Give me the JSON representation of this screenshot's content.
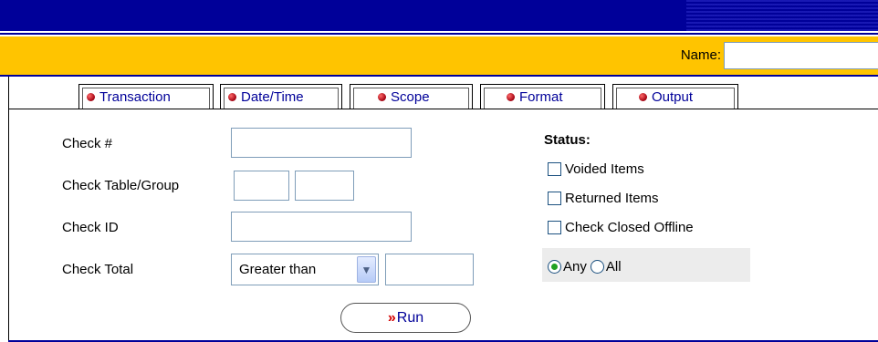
{
  "header": {
    "name_label": "Name:",
    "name_value": ""
  },
  "tabs": [
    {
      "label": "Transaction",
      "active": true
    },
    {
      "label": "Date/Time",
      "active": false
    },
    {
      "label": "Scope",
      "active": false
    },
    {
      "label": "Format",
      "active": false
    },
    {
      "label": "Output",
      "active": false
    }
  ],
  "form": {
    "check_number_label": "Check #",
    "check_table_group_label": "Check Table/Group",
    "check_id_label": "Check ID",
    "check_total_label": "Check Total",
    "check_total_operator": "Greater than",
    "run_label": "Run",
    "run_chevron": "»"
  },
  "status": {
    "title": "Status:",
    "options": [
      {
        "label": "Voided Items",
        "checked": false
      },
      {
        "label": "Returned Items",
        "checked": false
      },
      {
        "label": "Check Closed Offline",
        "checked": false
      }
    ],
    "match": {
      "any_label": "Any",
      "all_label": "All",
      "selected": "Any"
    }
  },
  "colors": {
    "header_blue": "#000099",
    "header_gold": "#ffc400",
    "tab_bullet": "#a00010",
    "run_chevron": "#d40000"
  }
}
